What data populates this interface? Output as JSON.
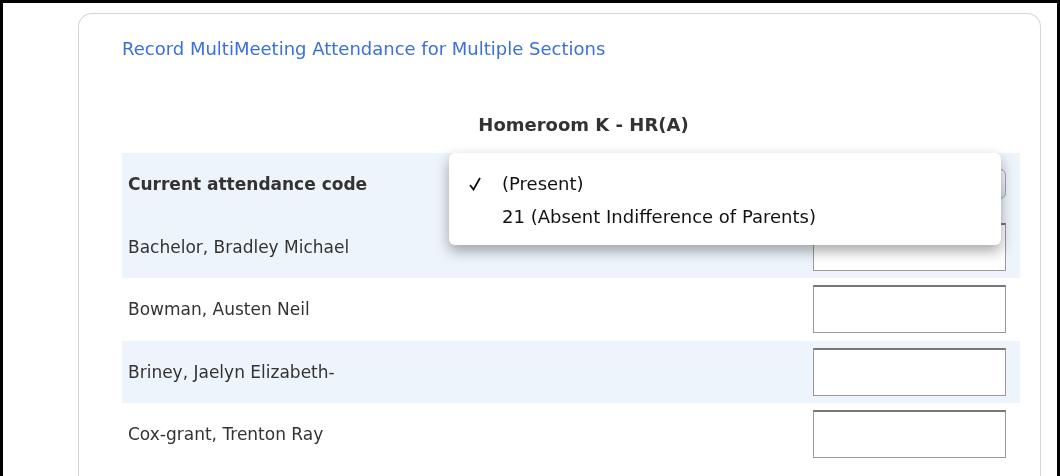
{
  "page_link": "Record MultiMeeting Attendance for Multiple Sections",
  "section_heading": "Homeroom K - HR(A)",
  "code_label": "Current attendance code",
  "code_menu": [
    {
      "label": "(Present)",
      "selected": true
    },
    {
      "label": "21 (Absent Indifference of Parents)",
      "selected": false
    }
  ],
  "students": [
    {
      "name": "Bachelor, Bradley Michael"
    },
    {
      "name": "Bowman, Austen Neil"
    },
    {
      "name": "Briney, Jaelyn Elizabeth-"
    },
    {
      "name": "Cox-grant, Trenton Ray"
    }
  ]
}
